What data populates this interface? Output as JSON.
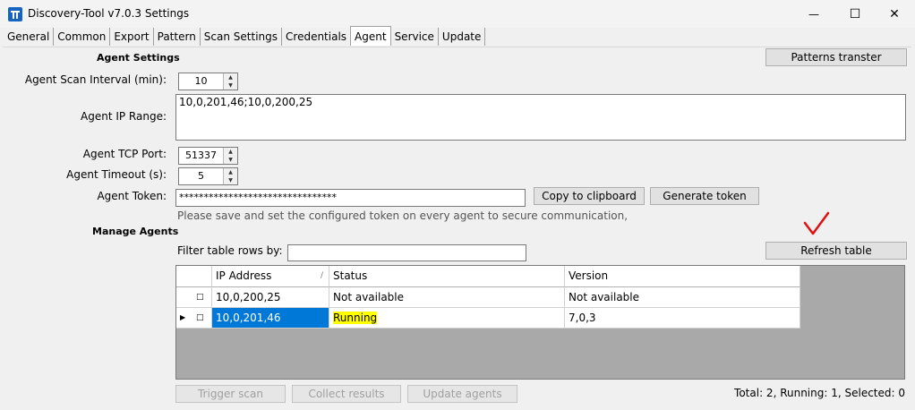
{
  "window": {
    "title": "Discovery-Tool v7.0.3 Settings",
    "minimize": "—",
    "maximize": "☐",
    "close": "✕"
  },
  "tabs": [
    "General",
    "Common",
    "Export",
    "Pattern",
    "Scan Settings",
    "Credentials",
    "Agent",
    "Service",
    "Update"
  ],
  "active_tab": "Agent",
  "agent_settings": {
    "section_label": "Agent Settings",
    "patterns_button": "Patterns transter",
    "scan_interval_label": "Agent Scan Interval (min):",
    "scan_interval_value": "10",
    "ip_range_label": "Agent IP Range:",
    "ip_range_value": "10,0,201,46;10,0,200,25",
    "tcp_port_label": "Agent TCP Port:",
    "tcp_port_value": "51337",
    "timeout_label": "Agent Timeout (s):",
    "timeout_value": "5",
    "token_label": "Agent Token:",
    "token_value": "********************************",
    "copy_button": "Copy to clipboard",
    "generate_button": "Generate token",
    "token_note": "Please save and set the configured token on every agent to secure communication,"
  },
  "manage_agents": {
    "section_label": "Manage Agents",
    "filter_label": "Filter table rows by:",
    "filter_value": "",
    "refresh_button": "Refresh table",
    "columns": [
      "IP Address",
      "Status",
      "Version"
    ],
    "sort_indicator": "/",
    "rows": [
      {
        "ip": "10,0,200,25",
        "status": "Not available",
        "version": "Not available"
      },
      {
        "ip": "10,0,201,46",
        "status": "Running",
        "version": "7,0,3"
      }
    ],
    "trigger_button": "Trigger scan",
    "collect_button": "Collect results",
    "update_button": "Update agents",
    "summary": "Total: 2, Running: 1, Selected: 0"
  },
  "colors": {
    "selection": "#0078d7",
    "running_highlight": "#ffff00",
    "annotation_check": "#e01010"
  }
}
